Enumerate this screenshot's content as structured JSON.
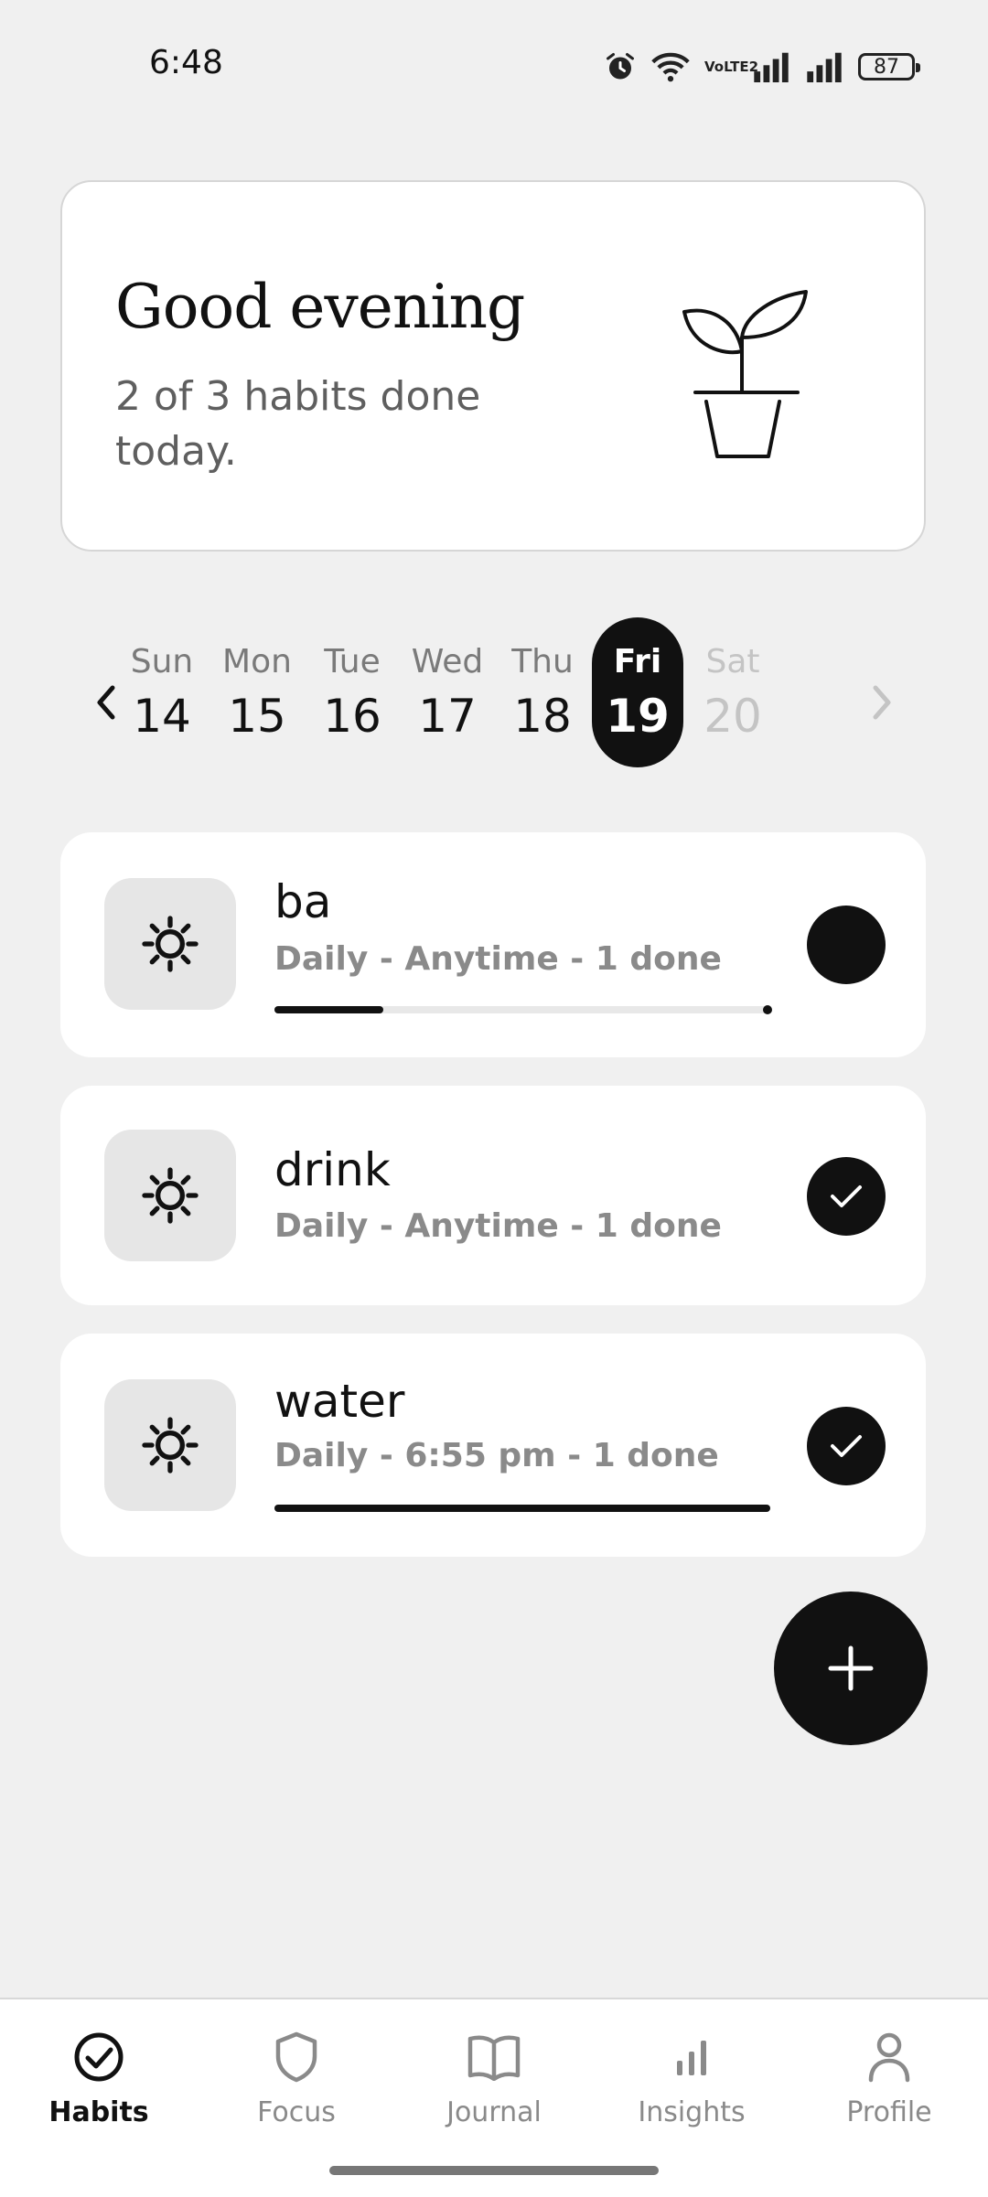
{
  "status_bar": {
    "time": "6:48",
    "battery": "87",
    "network_badge": "VoLTE2",
    "icons": [
      "alarm-icon",
      "wifi-icon",
      "volte-icon",
      "signal-icon",
      "signal-icon",
      "battery-icon"
    ]
  },
  "greeting": {
    "title": "Good evening",
    "subtitle": "2 of 3 habits done today.",
    "illustration": "plant-pot-icon"
  },
  "date_strip": {
    "prev_icon": "chevron-left-icon",
    "next_icon": "chevron-right-icon",
    "days": [
      {
        "name": "Sun",
        "date": "14"
      },
      {
        "name": "Mon",
        "date": "15"
      },
      {
        "name": "Tue",
        "date": "16"
      },
      {
        "name": "Wed",
        "date": "17"
      },
      {
        "name": "Thu",
        "date": "18"
      },
      {
        "name": "Fri",
        "date": "19",
        "selected": true
      },
      {
        "name": "Sat",
        "date": "20",
        "future": true
      }
    ]
  },
  "habits": [
    {
      "name": "ba",
      "meta": "Daily - Anytime - 1 done",
      "icon": "sun-icon",
      "completed": false,
      "progress": 0.22
    },
    {
      "name": "drink",
      "meta": "Daily - Anytime - 1 done",
      "icon": "sun-icon",
      "completed": true,
      "progress": null
    },
    {
      "name": "water",
      "meta": "Daily - 6:55 pm - 1 done",
      "icon": "sun-icon",
      "completed": true,
      "progress": 1.0
    }
  ],
  "fab": {
    "icon": "plus-icon"
  },
  "bottom_nav": [
    {
      "label": "Habits",
      "icon": "check-circle-icon",
      "active": true
    },
    {
      "label": "Focus",
      "icon": "shield-icon"
    },
    {
      "label": "Journal",
      "icon": "book-icon"
    },
    {
      "label": "Insights",
      "icon": "bar-chart-icon"
    },
    {
      "label": "Profile",
      "icon": "person-icon"
    }
  ],
  "colors": {
    "background": "#f0f0f0",
    "card": "#ffffff",
    "accent": "#111111",
    "muted_text": "#8a8a8a",
    "icon_box": "#e6e6e6"
  }
}
